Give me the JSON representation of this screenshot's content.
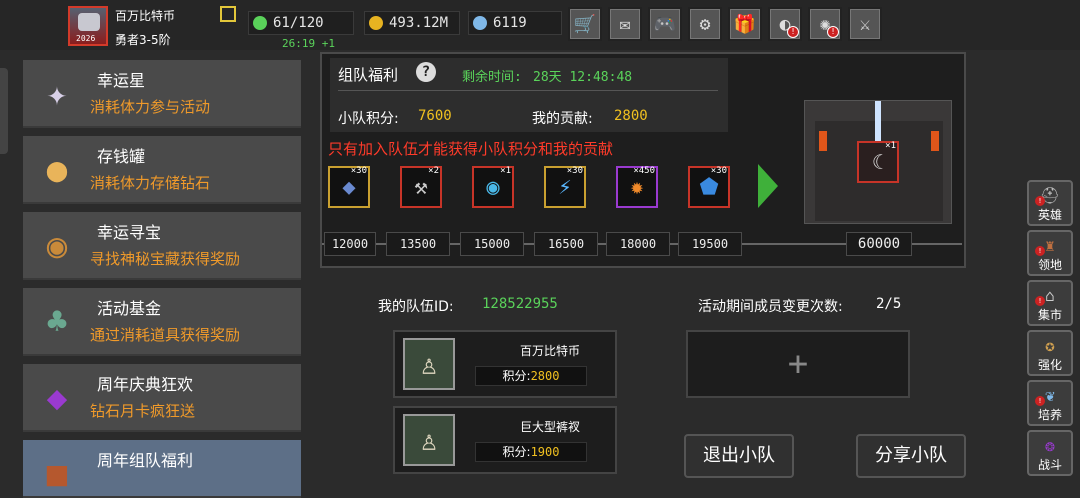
{
  "player": {
    "name": "百万比特币",
    "rank": "勇者3-5阶",
    "avatar_tag": "2026",
    "icon": "edit-icon"
  },
  "resources": {
    "stamina": "61/120",
    "gold": "493.12M",
    "gems": "6119",
    "regen_timer": "26:19 +1"
  },
  "toolbar": {
    "icons": [
      "cart-icon",
      "mail-icon",
      "gamepad-icon",
      "gear-icon",
      "gift-icon",
      "wheel-icon",
      "firework-icon",
      "battle-icon"
    ]
  },
  "menu": {
    "items": [
      {
        "title": "幸运星",
        "desc": "消耗体力参与活动",
        "icon": "star-icon"
      },
      {
        "title": "存钱罐",
        "desc": "消耗体力存储钻石",
        "icon": "piggy-bank-icon"
      },
      {
        "title": "幸运寻宝",
        "desc": "寻找神秘宝藏获得奖励",
        "icon": "treasure-icon"
      },
      {
        "title": "活动基金",
        "desc": "通过消耗道具获得奖励",
        "icon": "money-bag-icon"
      },
      {
        "title": "周年庆典狂欢",
        "desc": "钻石月卡疯狂送",
        "icon": "gem-card-icon"
      },
      {
        "title": "周年组队福利",
        "desc": "",
        "icon": "chest-icon"
      }
    ]
  },
  "event": {
    "title": "组队福利",
    "remain_label": "剩余时间:",
    "remain_value": "28天 12:48:48",
    "team_score_label": "小队积分:",
    "team_score": "7600",
    "my_contrib_label": "我的贡献:",
    "my_contrib": "2800",
    "warning": "只有加入队伍才能获得小队积分和我的贡献",
    "rewards": [
      {
        "count": "×30",
        "icon": "ore-icon",
        "color": "#c9a030"
      },
      {
        "count": "×2",
        "icon": "hammer-icon",
        "color": "#c73428"
      },
      {
        "count": "×1",
        "icon": "orb-icon",
        "color": "#c73428"
      },
      {
        "count": "×30",
        "icon": "lightning-icon",
        "color": "#c9a030"
      },
      {
        "count": "×450",
        "icon": "crystal-icon",
        "color": "#9a3ad0"
      },
      {
        "count": "×30",
        "icon": "shield-icon",
        "color": "#c73428"
      }
    ],
    "milestones": [
      "12000",
      "13500",
      "15000",
      "16500",
      "18000",
      "19500"
    ],
    "final_milestone": "60000",
    "final_reward": {
      "count": "×1",
      "icon": "portal-icon"
    }
  },
  "team": {
    "id_label": "我的队伍ID:",
    "id": "128522955",
    "changes_label": "活动期间成员变更次数:",
    "changes": "2/5",
    "members": [
      {
        "name": "百万比特币",
        "score_label": "积分:",
        "score": "2800"
      },
      {
        "name": "巨大型裤衩",
        "score_label": "积分:",
        "score": "1900"
      }
    ],
    "add_symbol": "+",
    "leave_button": "退出小队",
    "share_button": "分享小队"
  },
  "sidenav": {
    "items": [
      {
        "label": "英雄",
        "icon": "helmet-icon"
      },
      {
        "label": "领地",
        "icon": "castle-icon"
      },
      {
        "label": "集市",
        "icon": "market-icon"
      },
      {
        "label": "强化",
        "icon": "forge-icon"
      },
      {
        "label": "培养",
        "icon": "growth-icon"
      },
      {
        "label": "战斗",
        "icon": "vortex-icon"
      }
    ]
  }
}
